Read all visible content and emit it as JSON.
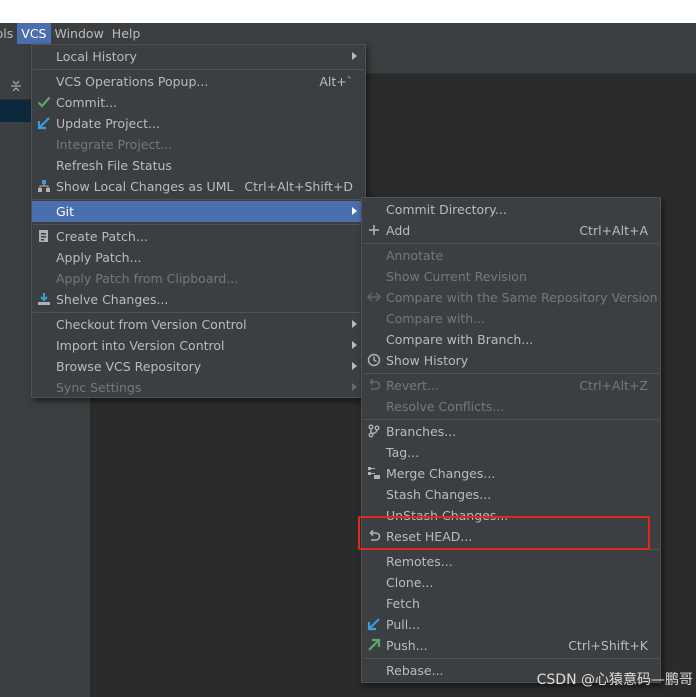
{
  "menubar": {
    "items": [
      "ools",
      "VCS",
      "Window",
      "Help"
    ]
  },
  "vcs_menu": {
    "local_history": "Local History",
    "operations_popup": "VCS Operations Popup...",
    "operations_popup_shortcut": "Alt+`",
    "commit": "Commit...",
    "update_project": "Update Project...",
    "integrate_project": "Integrate Project...",
    "refresh_file_status": "Refresh File Status",
    "show_local_changes_uml": "Show Local Changes as UML",
    "show_local_changes_uml_shortcut": "Ctrl+Alt+Shift+D",
    "git": "Git",
    "create_patch": "Create Patch...",
    "apply_patch": "Apply Patch...",
    "apply_patch_clipboard": "Apply Patch from Clipboard...",
    "shelve_changes": "Shelve Changes...",
    "checkout_vcs": "Checkout from Version Control",
    "import_vcs": "Import into Version Control",
    "browse_vcs_repo": "Browse VCS Repository",
    "sync_settings": "Sync Settings"
  },
  "git_menu": {
    "commit_directory": "Commit Directory...",
    "add": "Add",
    "add_shortcut": "Ctrl+Alt+A",
    "annotate": "Annotate",
    "show_current_revision": "Show Current Revision",
    "compare_same_repo": "Compare with the Same Repository Version",
    "compare_with": "Compare with...",
    "compare_with_branch": "Compare with Branch...",
    "show_history": "Show History",
    "revert": "Revert...",
    "revert_shortcut": "Ctrl+Alt+Z",
    "resolve_conflicts": "Resolve Conflicts...",
    "branches": "Branches...",
    "tag": "Tag...",
    "merge_changes": "Merge Changes...",
    "stash_changes": "Stash Changes...",
    "unstash_changes": "UnStash Changes...",
    "reset_head": "Reset HEAD...",
    "remotes": "Remotes...",
    "clone": "Clone...",
    "fetch": "Fetch",
    "pull": "Pull...",
    "push": "Push...",
    "push_shortcut": "Ctrl+Shift+K",
    "rebase": "Rebase..."
  },
  "watermark": "CSDN @心猿意码—鹏哥",
  "colors": {
    "menu_bg": "#3c3f41",
    "selection": "#4b6eaf",
    "disabled_text": "#777777",
    "highlight_box": "#e0281e"
  },
  "icons": {
    "commit": "green-check-icon",
    "update_project": "blue-arrow-down-left-icon",
    "show_local_changes_uml": "uml-diagram-icon",
    "create_patch": "patch-document-icon",
    "shelve_changes": "shelve-icon",
    "add": "plus-icon",
    "compare_same_repo": "compare-arrows-icon",
    "show_history": "clock-icon",
    "revert": "undo-icon",
    "branches": "branch-icon",
    "merge_changes": "merge-icon",
    "reset_head": "undo-icon",
    "pull": "blue-arrow-down-left-icon",
    "push": "green-arrow-up-right-icon"
  }
}
